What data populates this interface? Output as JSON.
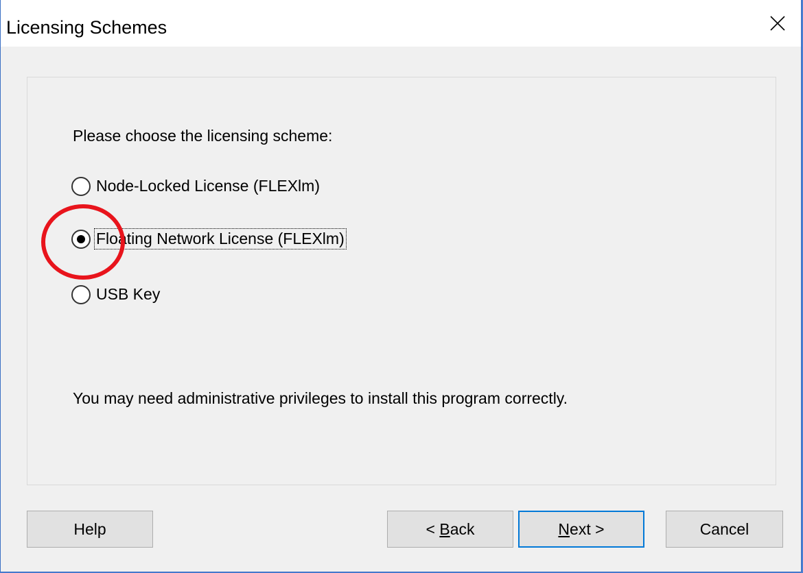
{
  "dialog": {
    "title": "Licensing Schemes",
    "close_icon": "close-x-icon"
  },
  "content": {
    "prompt": "Please choose the licensing scheme:",
    "options": [
      {
        "label": "Node-Locked License (FLEXlm)",
        "selected": false
      },
      {
        "label": "Floating Network License (FLEXlm)",
        "selected": true
      },
      {
        "label": "USB Key",
        "selected": false
      }
    ],
    "note": "You may need administrative privileges to install this program correctly."
  },
  "buttons": {
    "help": "Help",
    "back_prefix": "< ",
    "back_mnemonic": "B",
    "back_rest": "ack",
    "next_mnemonic": "N",
    "next_rest": "ext >",
    "cancel": "Cancel"
  },
  "colors": {
    "accent": "#0078d7",
    "annotation": "#e8141c",
    "dialog_bg": "#f0f0f0"
  }
}
